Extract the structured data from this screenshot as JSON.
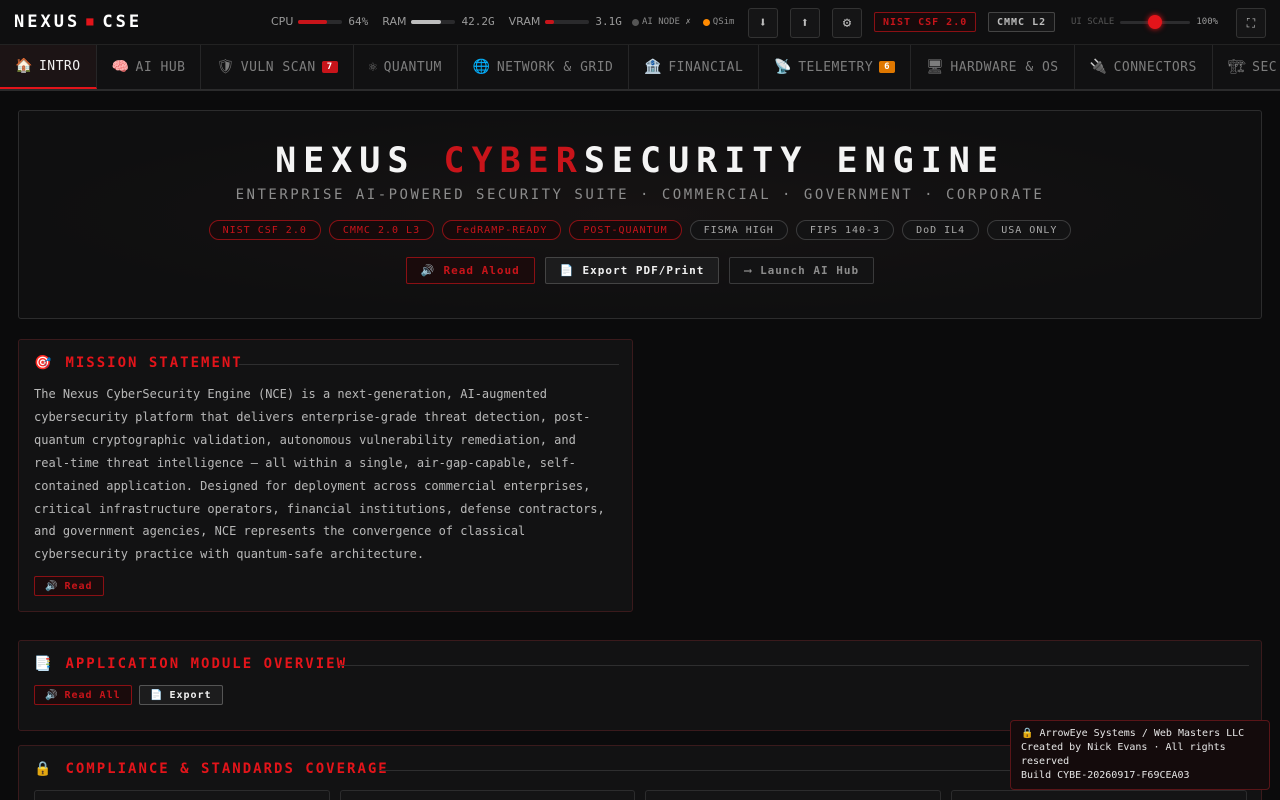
{
  "app": {
    "logo_left": "NEXUS",
    "logo_dot": "■",
    "logo_right": "CSE"
  },
  "meters": [
    {
      "label": "CPU",
      "value": "64%",
      "fill": 0.64,
      "color": "#c8141a"
    },
    {
      "label": "RAM",
      "value": "42.2G",
      "fill": 0.66,
      "color": "#bdbdbd"
    },
    {
      "label": "VRAM",
      "value": "3.1G",
      "fill": 0.2,
      "color": "#c8141a"
    }
  ],
  "status": {
    "ai_node": "AI NODE ✗",
    "ai_node_color": "#555555",
    "qsim": "QSim",
    "qsim_color": "#ff8a00"
  },
  "top_badges": {
    "nist": "NIST CSF 2.0",
    "cmmc": "CMMC L2"
  },
  "ui_scale": {
    "label": "UI SCALE",
    "value": "100%",
    "level": 0.5
  },
  "tabs": [
    {
      "icon": "🏠",
      "icon_name": "home-icon",
      "label": "INTRO",
      "active": true
    },
    {
      "icon": "🧠",
      "icon_name": "brain-icon",
      "label": "AI HUB"
    },
    {
      "icon": "🛡",
      "icon_name": "shield-icon",
      "label": "VULN SCAN",
      "count": "7",
      "count_color": "#c8141a"
    },
    {
      "icon": "⚛",
      "icon_name": "atom-icon",
      "label": "QUANTUM"
    },
    {
      "icon": "🌐",
      "icon_name": "globe-icon",
      "label": "NETWORK & GRID"
    },
    {
      "icon": "🏦",
      "icon_name": "bank-icon",
      "label": "FINANCIAL"
    },
    {
      "icon": "📡",
      "icon_name": "satellite-icon",
      "label": "TELEMETRY",
      "count": "6",
      "count_color": "#e07800"
    },
    {
      "icon": "🖥",
      "icon_name": "desktop-icon",
      "label": "HARDWARE & OS"
    },
    {
      "icon": "🔌",
      "icon_name": "plug-icon",
      "label": "CONNECTORS"
    },
    {
      "icon": "🏗",
      "icon_name": "construction-icon",
      "label": "SEC BU"
    }
  ],
  "hero": {
    "title_a": "NEXUS ",
    "title_red": "CYBER",
    "title_b": "SECURITY ENGINE",
    "subtitle": "ENTERPRISE AI-POWERED SECURITY SUITE · COMMERCIAL · GOVERNMENT · CORPORATE",
    "pills": [
      {
        "label": "NIST CSF 2.0",
        "style": "red"
      },
      {
        "label": "CMMC 2.0 L3",
        "style": "red"
      },
      {
        "label": "FedRAMP-READY",
        "style": "red"
      },
      {
        "label": "POST-QUANTUM",
        "style": "red"
      },
      {
        "label": "FISMA HIGH",
        "style": "gray"
      },
      {
        "label": "FIPS 140-3",
        "style": "gray"
      },
      {
        "label": "DoD IL4",
        "style": "gray"
      },
      {
        "label": "USA ONLY",
        "style": "gray"
      }
    ],
    "read_aloud": "Read Aloud",
    "export": "Export PDF/Print",
    "launch": "Launch AI Hub"
  },
  "mission": {
    "title": "MISSION STATEMENT",
    "text": "The Nexus CyberSecurity Engine (NCE) is a next-generation, AI-augmented cybersecurity platform that delivers enterprise-grade threat detection, post-quantum cryptographic validation, autonomous vulnerability remediation, and real-time threat intelligence — all within a single, air-gap-capable, self-contained application. Designed for deployment across commercial enterprises, critical infrastructure operators, financial institutions, defense contractors, and government agencies, NCE represents the convergence of classical cybersecurity practice with quantum-safe architecture.",
    "read": "Read"
  },
  "modules": {
    "title": "APPLICATION MODULE OVERVIEW",
    "read_all": "Read All",
    "export": "Export"
  },
  "compliance": {
    "title": "COMPLIANCE & STANDARDS COVERAGE"
  },
  "credit": {
    "line1": "🔒 ArrowEye Systems / Web Masters LLC",
    "line2": "Created by Nick Evans · All rights reserved",
    "line3": "Build CYBE-20260917-F69CEA03"
  }
}
